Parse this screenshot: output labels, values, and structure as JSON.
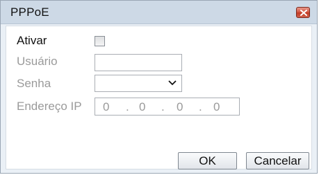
{
  "window": {
    "title": "PPPoE"
  },
  "form": {
    "enable_label": "Ativar",
    "user_label": "Usuário",
    "user_value": "",
    "password_label": "Senha",
    "password_value": "",
    "ip_label": "Endereço IP",
    "ip_octets": [
      "0",
      "0",
      "0",
      "0"
    ],
    "ip_separator": "."
  },
  "buttons": {
    "ok": "OK",
    "cancel": "Cancelar"
  },
  "icons": {
    "close": "close-icon",
    "dropdown": "chevron-down-icon"
  },
  "colors": {
    "titlebar": "#cdd9e6",
    "close_button": "#d45a45",
    "disabled_text": "#9a9a9a"
  }
}
